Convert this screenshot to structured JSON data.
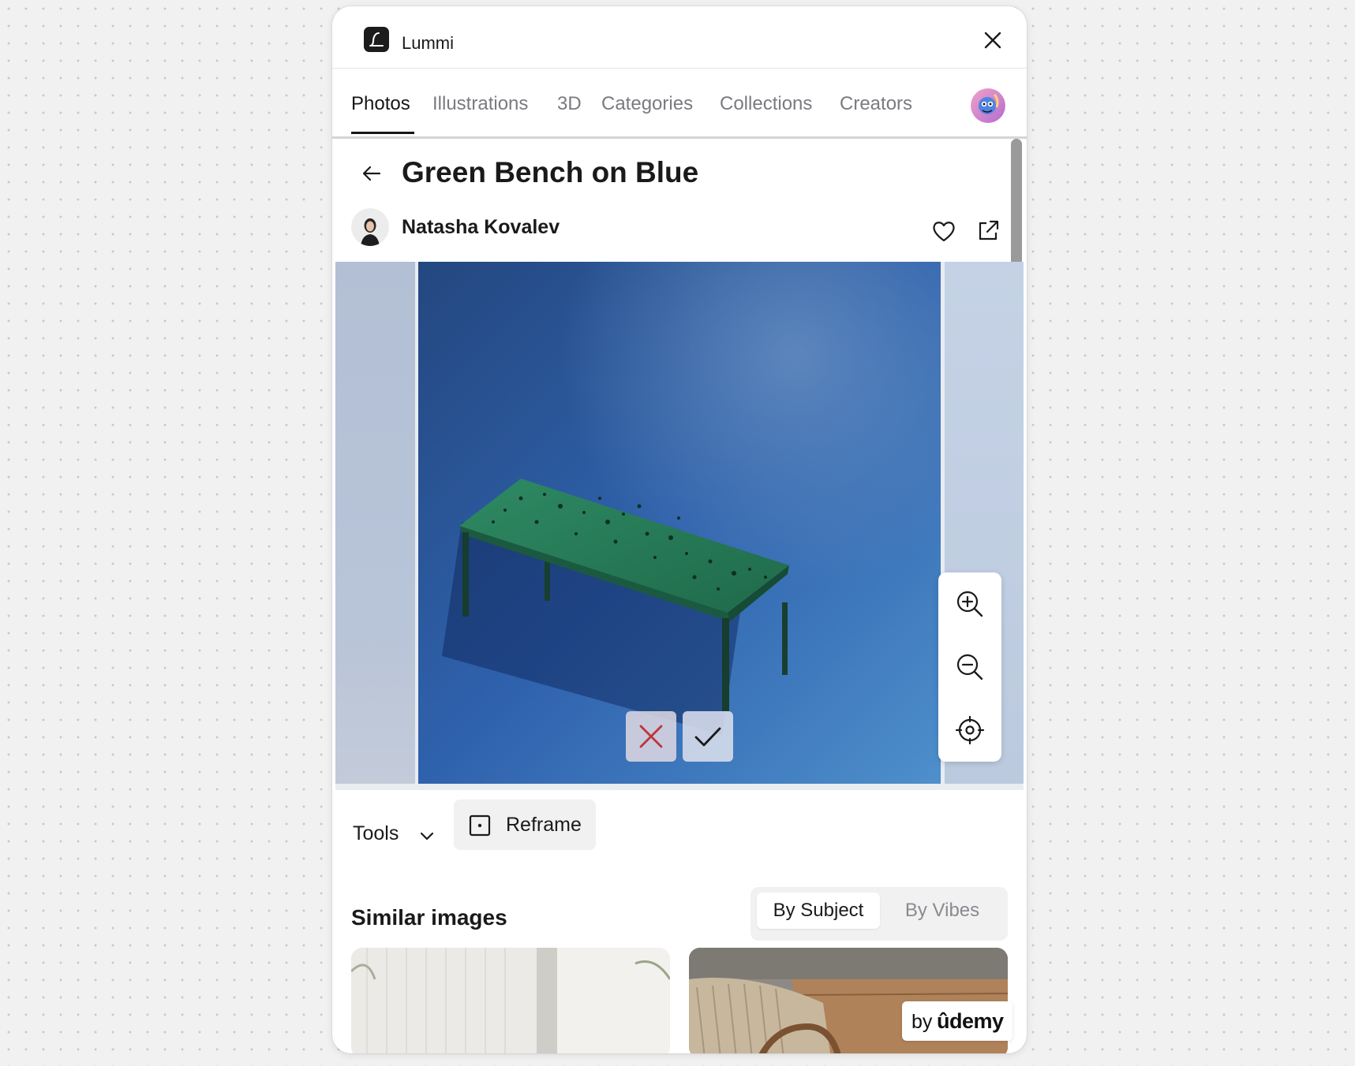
{
  "app": {
    "title": "Lummi"
  },
  "nav": {
    "tabs": [
      {
        "label": "Photos",
        "active": true
      },
      {
        "label": "Illustrations",
        "active": false
      },
      {
        "label": "3D",
        "active": false
      },
      {
        "label": "Categories",
        "active": false
      },
      {
        "label": "Collections",
        "active": false
      },
      {
        "label": "Creators",
        "active": false
      }
    ]
  },
  "photo": {
    "title": "Green Bench on Blue",
    "author": "Natasha Kovalev"
  },
  "toolbar": {
    "tools_label": "Tools",
    "reframe_label": "Reframe"
  },
  "similar": {
    "title": "Similar images",
    "toggle": [
      {
        "label": "By Subject",
        "active": true
      },
      {
        "label": "By Vibes",
        "active": false
      }
    ]
  },
  "badge": {
    "by": "by",
    "brand": "ûdemy"
  },
  "icons": {
    "close": "close-icon",
    "back": "arrow-left-icon",
    "like": "heart-icon",
    "share": "external-link-icon",
    "zoom_in": "zoom-in-icon",
    "zoom_out": "zoom-out-icon",
    "recenter": "crosshair-icon",
    "cancel": "x-icon",
    "confirm": "check-icon",
    "tools": "chevron-down-icon",
    "reframe": "frame-icon"
  },
  "colors": {
    "accent_cancel": "#c0343a",
    "photo_background": "#2f5fa8",
    "bench": "#1f6a4a"
  }
}
